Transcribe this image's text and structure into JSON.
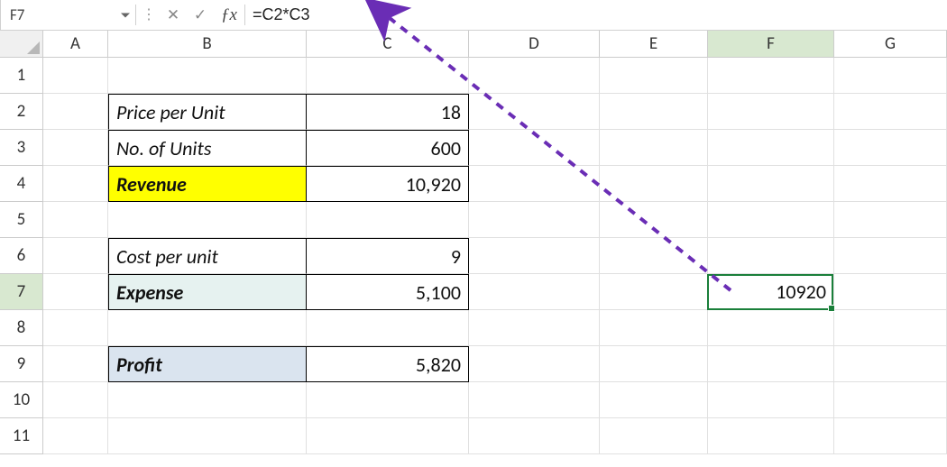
{
  "name_box": "F7",
  "formula": "=C2*C3",
  "columns": [
    "A",
    "B",
    "C",
    "D",
    "E",
    "F",
    "G"
  ],
  "row_numbers": [
    "1",
    "2",
    "3",
    "4",
    "5",
    "6",
    "7",
    "8",
    "9",
    "10",
    "11"
  ],
  "active_row": "7",
  "active_col": "F",
  "data": {
    "b2": "Price per Unit",
    "c2": "18",
    "b3": "No. of Units",
    "c3": "600",
    "b4": "Revenue",
    "c4": "10,920",
    "b6": "Cost per unit",
    "c6": "9",
    "b7": "Expense",
    "c7": "5,100",
    "b9": "Profit",
    "c9": "5,820",
    "f7": "10920"
  },
  "arrow_color": "#6a2db5",
  "icons": {
    "cancel": "✕",
    "confirm": "✓"
  }
}
